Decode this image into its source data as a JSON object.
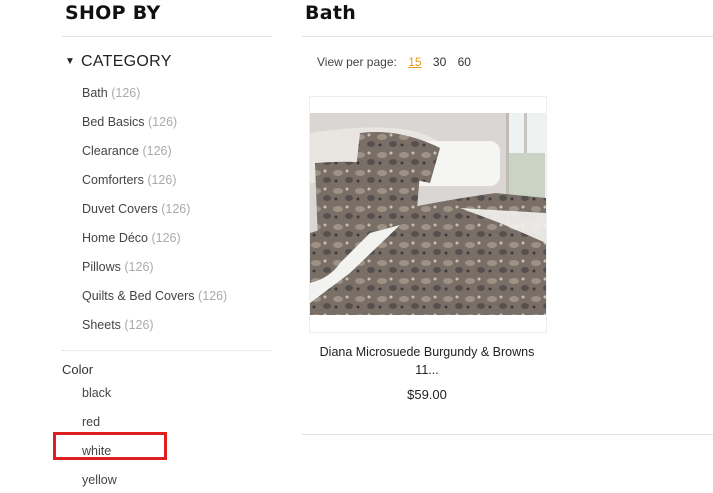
{
  "sidebar": {
    "title": "SHOP BY",
    "category_heading": "CATEGORY",
    "categories": [
      {
        "name": "Bath",
        "count": "(126)"
      },
      {
        "name": "Bed Basics",
        "count": "(126)"
      },
      {
        "name": "Clearance",
        "count": "(126)"
      },
      {
        "name": "Comforters",
        "count": "(126)"
      },
      {
        "name": "Duvet Covers",
        "count": "(126)"
      },
      {
        "name": "Home Déco",
        "count": "(126)"
      },
      {
        "name": "Pillows",
        "count": "(126)"
      },
      {
        "name": "Quilts & Bed Covers",
        "count": "(126)"
      },
      {
        "name": "Sheets",
        "count": "(126)"
      }
    ],
    "color_heading": "Color",
    "colors": [
      "black",
      "red",
      "white",
      "yellow"
    ]
  },
  "main": {
    "title": "Bath",
    "view_per_page_label": "View per page:",
    "view_options": [
      "15",
      "30",
      "60"
    ],
    "active_view_option": "15",
    "product": {
      "name": "Diana Microsuede Burgundy & Browns 11...",
      "price": "$59.00"
    }
  },
  "colors": {
    "highlight": "#e02020",
    "active_link": "#e59a1a"
  }
}
